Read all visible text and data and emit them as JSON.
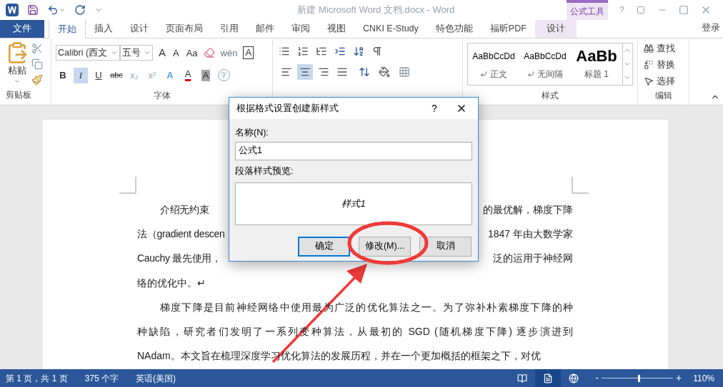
{
  "window": {
    "title": "新建 Microsoft Word 文档.docx - Word",
    "context_group": "公式工具",
    "sign_in": "登录",
    "help": "?"
  },
  "tabs": [
    {
      "label": "文件",
      "kind": "file",
      "selected": false
    },
    {
      "label": "开始",
      "kind": "tab",
      "selected": true
    },
    {
      "label": "插入",
      "kind": "tab",
      "selected": false
    },
    {
      "label": "设计",
      "kind": "tab",
      "selected": false
    },
    {
      "label": "页面布局",
      "kind": "tab",
      "selected": false
    },
    {
      "label": "引用",
      "kind": "tab",
      "selected": false
    },
    {
      "label": "邮件",
      "kind": "tab",
      "selected": false
    },
    {
      "label": "审阅",
      "kind": "tab",
      "selected": false
    },
    {
      "label": "视图",
      "kind": "tab",
      "selected": false
    },
    {
      "label": "CNKI E-Study",
      "kind": "tab",
      "selected": false
    },
    {
      "label": "特色功能",
      "kind": "tab",
      "selected": false
    },
    {
      "label": "福昕PDF",
      "kind": "tab",
      "selected": false
    },
    {
      "label": "设计",
      "kind": "context",
      "selected": false
    }
  ],
  "ribbon": {
    "clipboard": {
      "paste": "粘贴",
      "label": "剪贴板"
    },
    "font": {
      "font_name": "Calibri (西文",
      "font_size": "五号",
      "label": "字体",
      "row1": [
        {
          "text": "A",
          "kind": "grow"
        },
        {
          "text": "A",
          "kind": "shrink"
        },
        {
          "text": "Aa",
          "kind": "case"
        },
        {
          "text": "wén",
          "kind": "phonetic"
        },
        {
          "text": "A",
          "kind": "border"
        }
      ],
      "row2": [
        {
          "text": "B",
          "kind": "bold",
          "selected": false
        },
        {
          "text": "I",
          "kind": "italic",
          "selected": true
        },
        {
          "text": "U",
          "kind": "underline",
          "selected": false
        },
        {
          "text": "abc",
          "kind": "strike",
          "selected": false
        },
        {
          "text": "x₂",
          "kind": "sub",
          "selected": false
        },
        {
          "text": "x²",
          "kind": "sup",
          "selected": false
        },
        {
          "text": "A",
          "kind": "effect",
          "selected": false
        },
        {
          "text": "A",
          "kind": "color",
          "selected": false
        },
        {
          "text": "A",
          "kind": "shade",
          "selected": false
        },
        {
          "text": "字",
          "kind": "enclose",
          "selected": false
        }
      ]
    },
    "paragraph": {
      "alignments": [
        {
          "kind": "left",
          "selected": false
        },
        {
          "kind": "center",
          "selected": true
        },
        {
          "kind": "right",
          "selected": false
        },
        {
          "kind": "justify",
          "selected": false
        }
      ]
    },
    "styles": {
      "label": "样式",
      "items": [
        {
          "preview": "AaBbCcDd",
          "name": "正文",
          "kind": "normal"
        },
        {
          "preview": "AaBbCcDd",
          "name": "无间隔",
          "kind": "normal"
        },
        {
          "preview": "AaBb",
          "name": "标题 1",
          "kind": "heading"
        }
      ]
    },
    "editing": {
      "label": "编辑",
      "items": [
        {
          "label": "查找",
          "kind": "find"
        },
        {
          "label": "替换",
          "kind": "replace"
        },
        {
          "label": "选择",
          "kind": "select"
        }
      ]
    }
  },
  "document": {
    "paragraphs": [
      {
        "lines": [
          {
            "left": "介绍无约束",
            "right": "的最优解，梯度下降"
          },
          {
            "left": "法（gradient descen",
            "right": "1847  年由大数学家"
          },
          {
            "left": "Cauchy  最先使用，",
            "right": "泛的运用于神经网"
          },
          {
            "left": "络的优化中。↵"
          }
        ]
      },
      {
        "lines": [
          {
            "left": "梯度下降是目前神经网络中使用最为广泛的优化算法之一。为了弥补朴素梯度下降的种"
          },
          {
            "left": "种缺陷，研究者们发明了一系列变种算法，从最初的  SGD (随机梯度下降)  逐步演进到"
          },
          {
            "left": "NAdam。本文旨在梳理深度学习优化算法的发展历程，并在一个更加概括的框架之下，对优"
          }
        ]
      }
    ]
  },
  "dialog": {
    "title": "根据格式设置创建新样式",
    "help": "?",
    "name_label": "名称(N):",
    "name_value": "公式1",
    "preview_label": "段落样式预览:",
    "preview_text": "样式1",
    "buttons": [
      {
        "label": "确定",
        "kind": "default"
      },
      {
        "label": "修改(M)...",
        "kind": "normal"
      },
      {
        "label": "取消",
        "kind": "normal"
      }
    ]
  },
  "status_bar": {
    "page": "第 1 页，共 1 页",
    "words": "375 个字",
    "language": "英语(美国)",
    "views": [
      {
        "kind": "read",
        "selected": false
      },
      {
        "kind": "print",
        "selected": true
      },
      {
        "kind": "web",
        "selected": false
      }
    ],
    "zoom": {
      "minus": "-",
      "plus": "+",
      "level": 0.52,
      "reading": "110%"
    }
  }
}
